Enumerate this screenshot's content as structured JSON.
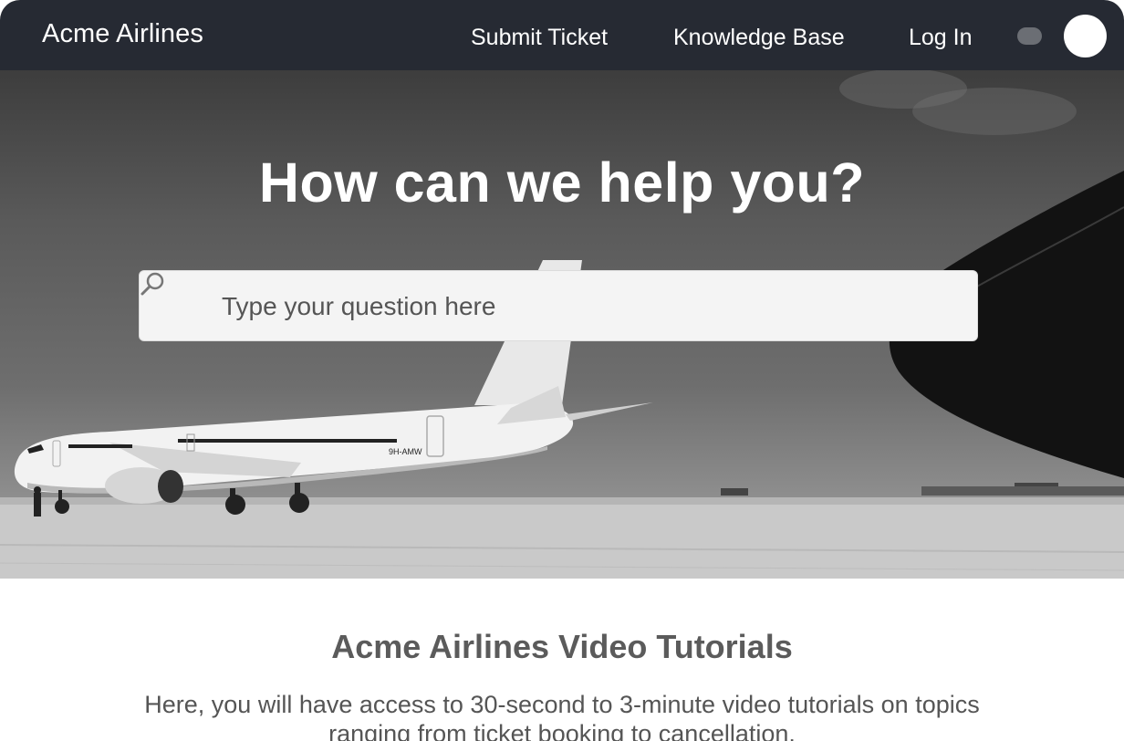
{
  "header": {
    "brand": "Acme Airlines",
    "nav": {
      "submit_ticket": "Submit Ticket",
      "knowledge_base": "Knowledge Base",
      "log_in": "Log In"
    }
  },
  "hero": {
    "title": "How can we help you?",
    "search": {
      "placeholder": "Type your question here",
      "value": ""
    },
    "aircraft_registration": "9H-AMW"
  },
  "content": {
    "title": "Acme Airlines Video Tutorials",
    "description": "Here, you will have access to 30-second to 3-minute video tutorials on topics ranging from ticket booking to cancellation."
  },
  "colors": {
    "header_bg": "#262a33",
    "hero_title": "#ffffff",
    "section_title": "#5b5b5b",
    "body_text": "#555555"
  },
  "icons": [
    "search-icon"
  ]
}
